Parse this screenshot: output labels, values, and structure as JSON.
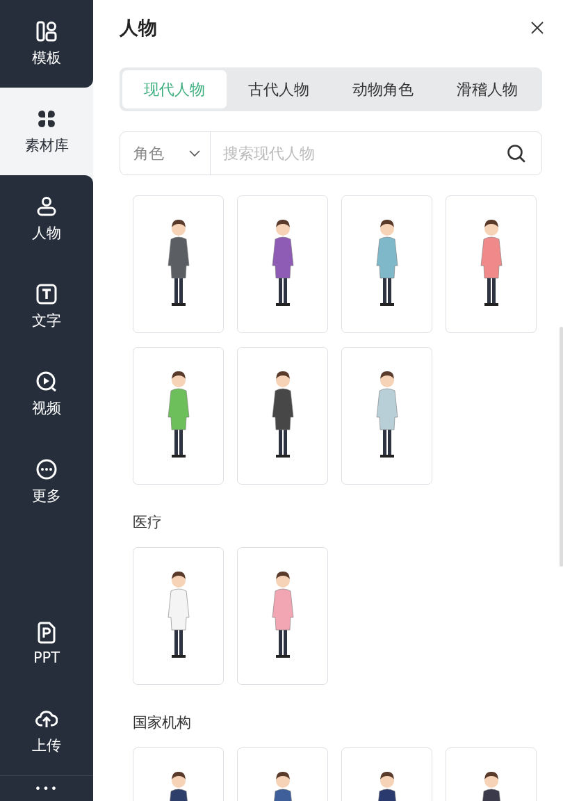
{
  "sidebar": {
    "items": [
      {
        "label": "模板",
        "selected": false
      },
      {
        "label": "素材库",
        "selected": true
      },
      {
        "label": "人物",
        "selected": false
      },
      {
        "label": "文字",
        "selected": false
      },
      {
        "label": "视频",
        "selected": false
      },
      {
        "label": "更多",
        "selected": false
      },
      {
        "label": "PPT",
        "selected": false
      },
      {
        "label": "上传",
        "selected": false
      }
    ],
    "more": "•••"
  },
  "panel": {
    "title": "人物",
    "tabs": [
      {
        "label": "现代人物",
        "selected": true
      },
      {
        "label": "古代人物",
        "selected": false
      },
      {
        "label": "动物角色",
        "selected": false
      },
      {
        "label": "滑稽人物",
        "selected": false
      }
    ],
    "filter": {
      "label": "角色"
    },
    "search": {
      "placeholder": "搜索现代人物"
    },
    "sections": [
      {
        "cards": [
          {
            "color": "#5b5e63"
          },
          {
            "color": "#8e5bb5"
          },
          {
            "color": "#7fb8c8"
          },
          {
            "color": "#f08a8a"
          },
          {
            "color": "#6cbf5a"
          },
          {
            "color": "#474747"
          },
          {
            "color": "#b9cfd8"
          }
        ]
      },
      {
        "heading": "医疗",
        "cards": [
          {
            "color": "#f4f4f4"
          },
          {
            "color": "#f2a6b4"
          }
        ]
      },
      {
        "heading": "国家机构",
        "cards": [
          {
            "color": "#2d3e6b"
          },
          {
            "color": "#3e5f9a"
          },
          {
            "color": "#2b3a6e"
          },
          {
            "color": "#3a3a4a"
          }
        ]
      }
    ]
  }
}
